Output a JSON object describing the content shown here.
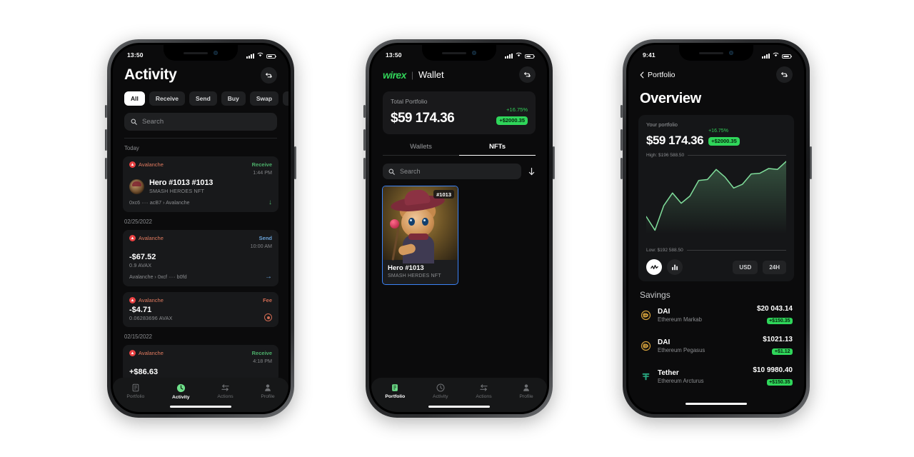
{
  "phone1": {
    "status": {
      "time": "13:50"
    },
    "header": {
      "title": "Activity",
      "sync_icon": "sync-icon"
    },
    "filters": [
      {
        "label": "All",
        "active": true
      },
      {
        "label": "Receive",
        "active": false
      },
      {
        "label": "Send",
        "active": false
      },
      {
        "label": "Buy",
        "active": false
      },
      {
        "label": "Swap",
        "active": false
      },
      {
        "label": "Approv",
        "active": false
      }
    ],
    "search": {
      "placeholder": "Search",
      "icon": "search-icon"
    },
    "groups": [
      {
        "date": "Today",
        "items": [
          {
            "chain": "Avalanche",
            "kind": "Receive",
            "kind_class": "receive",
            "time": "1:44 PM",
            "name": "Hero #1013 #1013",
            "sub": "SMASH HEROES NFT",
            "addr": "0xc6 ···· acB7  ›  Avalanche",
            "has_thumb": true,
            "arrow": "↓"
          }
        ]
      },
      {
        "date": "02/25/2022",
        "items": [
          {
            "chain": "Avalanche",
            "kind": "Send",
            "kind_class": "send",
            "time": "10:00 AM",
            "name": "-$67.52",
            "sub": "0.9 AVAX",
            "addr": "Avalanche  ›  0xcf ···· b0fd",
            "has_thumb": false,
            "arrow": "→"
          },
          {
            "chain": "Avalanche",
            "kind": "Fee",
            "kind_class": "fee",
            "time": "",
            "name": "-$4.71",
            "sub": "0.06283696 AVAX",
            "addr": "",
            "has_thumb": false,
            "arrow": "fee"
          }
        ]
      },
      {
        "date": "02/15/2022",
        "items": [
          {
            "chain": "Avalanche",
            "kind": "Receive",
            "kind_class": "receive",
            "time": "4:18 PM",
            "name": "+$86.63",
            "sub": "",
            "addr": "",
            "has_thumb": false,
            "arrow": "↓"
          }
        ]
      }
    ],
    "tabs": [
      {
        "label": "Portfolio",
        "icon": "document-icon",
        "active": false
      },
      {
        "label": "Activity",
        "icon": "clock-icon",
        "active": true
      },
      {
        "label": "Actions",
        "icon": "swap-arrows-icon",
        "active": false
      },
      {
        "label": "Profile",
        "icon": "person-icon",
        "active": false
      }
    ]
  },
  "phone2": {
    "status": {
      "time": "13:50"
    },
    "header": {
      "brand": "wirex",
      "separator": "|",
      "section": "Wallet",
      "sync_icon": "sync-icon"
    },
    "portfolio": {
      "label": "Total Portfolio",
      "amount": "$59 174.36",
      "percent": "+16.75%",
      "change": "+$2000.35"
    },
    "tabs": [
      {
        "label": "Wallets",
        "active": false
      },
      {
        "label": "NFTs",
        "active": true
      }
    ],
    "search": {
      "placeholder": "Search",
      "icon": "search-icon",
      "download_icon": "download-icon"
    },
    "nfts": [
      {
        "tag": "#1013",
        "title": "Hero #1013",
        "collection": "SMASH HERDES NFT"
      }
    ],
    "tabs_bottom": [
      {
        "label": "Portfolio",
        "icon": "document-icon",
        "active": true
      },
      {
        "label": "Activity",
        "icon": "clock-icon",
        "active": false
      },
      {
        "label": "Actions",
        "icon": "swap-arrows-icon",
        "active": false
      },
      {
        "label": "Profile",
        "icon": "person-icon",
        "active": false
      }
    ]
  },
  "phone3": {
    "status": {
      "time": "9:41"
    },
    "nav": {
      "back_label": "Portfolio",
      "back_icon": "chevron-left-icon",
      "sync_icon": "sync-icon"
    },
    "title": "Overview",
    "overview": {
      "label": "Your portfolio",
      "amount": "$59 174.36",
      "percent": "+16.75%",
      "change": "+$2000.35"
    },
    "chart_labels": {
      "high": "High: $196 588.50",
      "low": "Low: $192 588.50"
    },
    "controls": {
      "line_icon": "line-chart-icon",
      "bar_icon": "bar-chart-icon",
      "currency": "USD",
      "range": "24H"
    },
    "savings": {
      "title": "Savings",
      "rows": [
        {
          "symbol": "D",
          "name": "DAI",
          "sub": "Ethereum Markab",
          "value": "$20 043.14",
          "change": "+$150.35",
          "color": "#d6a23c"
        },
        {
          "symbol": "D",
          "name": "DAI",
          "sub": "Ethereum Pegasus",
          "value": "$1021.13",
          "change": "+$1.12",
          "color": "#d6a23c"
        },
        {
          "symbol": "T",
          "name": "Tether",
          "sub": "Ethereum Arcturus",
          "value": "$10 9980.40",
          "change": "+$150.35",
          "color": "#26a17b"
        }
      ]
    },
    "tabs_bottom": [
      {
        "label": "Portfolio",
        "icon": "document-icon",
        "active": true
      },
      {
        "label": "Activity",
        "icon": "clock-icon",
        "active": false
      },
      {
        "label": "Actions",
        "icon": "swap-arrows-icon",
        "active": false
      },
      {
        "label": "Profile",
        "icon": "person-icon",
        "active": false
      }
    ]
  },
  "chart_data": {
    "type": "line",
    "title": "Your portfolio",
    "ylabel": "USD",
    "xlabel": "24H",
    "grid": false,
    "legend": "none",
    "ylim": [
      192588.5,
      196588.5
    ],
    "high_label": "High: $196 588.50",
    "low_label": "Low: $192 588.50",
    "line_color": "#7fdc9a",
    "fill": "gradient-green-transparent",
    "x": [
      0,
      1,
      2,
      3,
      4,
      5,
      6,
      7,
      8,
      9,
      10,
      11,
      12,
      13,
      14,
      15,
      16
    ],
    "values": [
      193480,
      192760,
      194050,
      194720,
      194180,
      194560,
      195380,
      195430,
      195960,
      195560,
      194980,
      195180,
      195720,
      195760,
      196010,
      195960,
      196380
    ]
  }
}
